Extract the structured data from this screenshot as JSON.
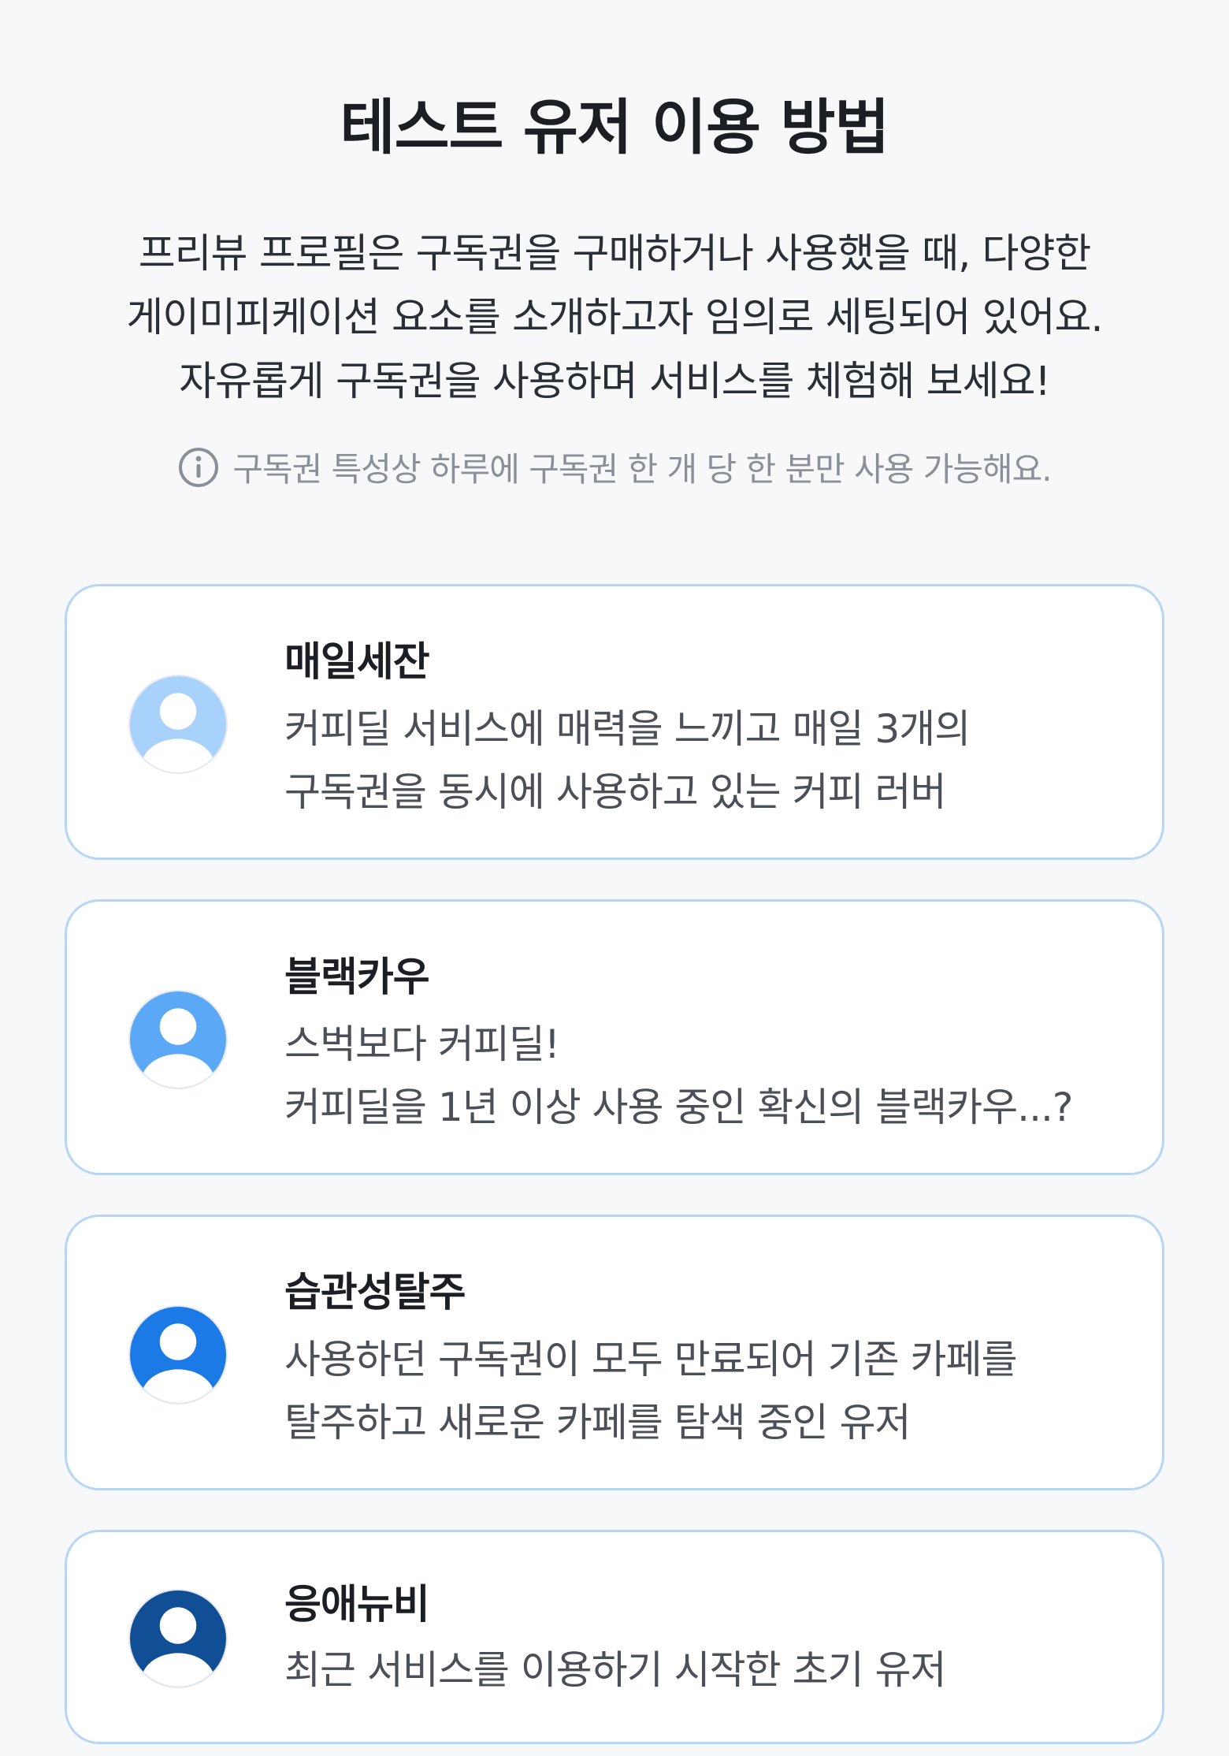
{
  "header": {
    "title": "테스트 유저 이용 방법",
    "description": [
      "프리뷰 프로필은 구독권을 구매하거나 사용했을 때, 다양한",
      "게이미피케이션 요소를 소개하고자 임의로 세팅되어 있어요.",
      "자유롭게 구독권을 사용하며 서비스를 체험해 보세요!"
    ],
    "notice_icon": "info-icon",
    "notice": "구독권 특성상 하루에 구독권 한 개 당 한 분만 사용 가능해요."
  },
  "users": [
    {
      "name": "매일세잔",
      "avatar_color": "#a8d1fb",
      "description": [
        "커피딜 서비스에 매력을 느끼고 매일 3개의",
        "구독권을 동시에 사용하고 있는 커피 러버"
      ]
    },
    {
      "name": "블랙카우",
      "avatar_color": "#5aa8f6",
      "description": [
        "스벅보다 커피딜!",
        "커피딜을 1년 이상 사용 중인 확신의 블랙카우...?"
      ]
    },
    {
      "name": "습관성탈주",
      "avatar_color": "#1b7ae6",
      "description": [
        "사용하던 구독권이 모두 만료되어 기존 카페를",
        "탈주하고 새로운 카페를 탐색 중인 유저"
      ]
    },
    {
      "name": "응애뉴비",
      "avatar_color": "#104e96",
      "description": [
        "최근 서비스를 이용하기 시작한 초기 유저"
      ]
    }
  ],
  "colors": {
    "background": "#f7f8fa",
    "card_border": "#b7d6f6"
  }
}
